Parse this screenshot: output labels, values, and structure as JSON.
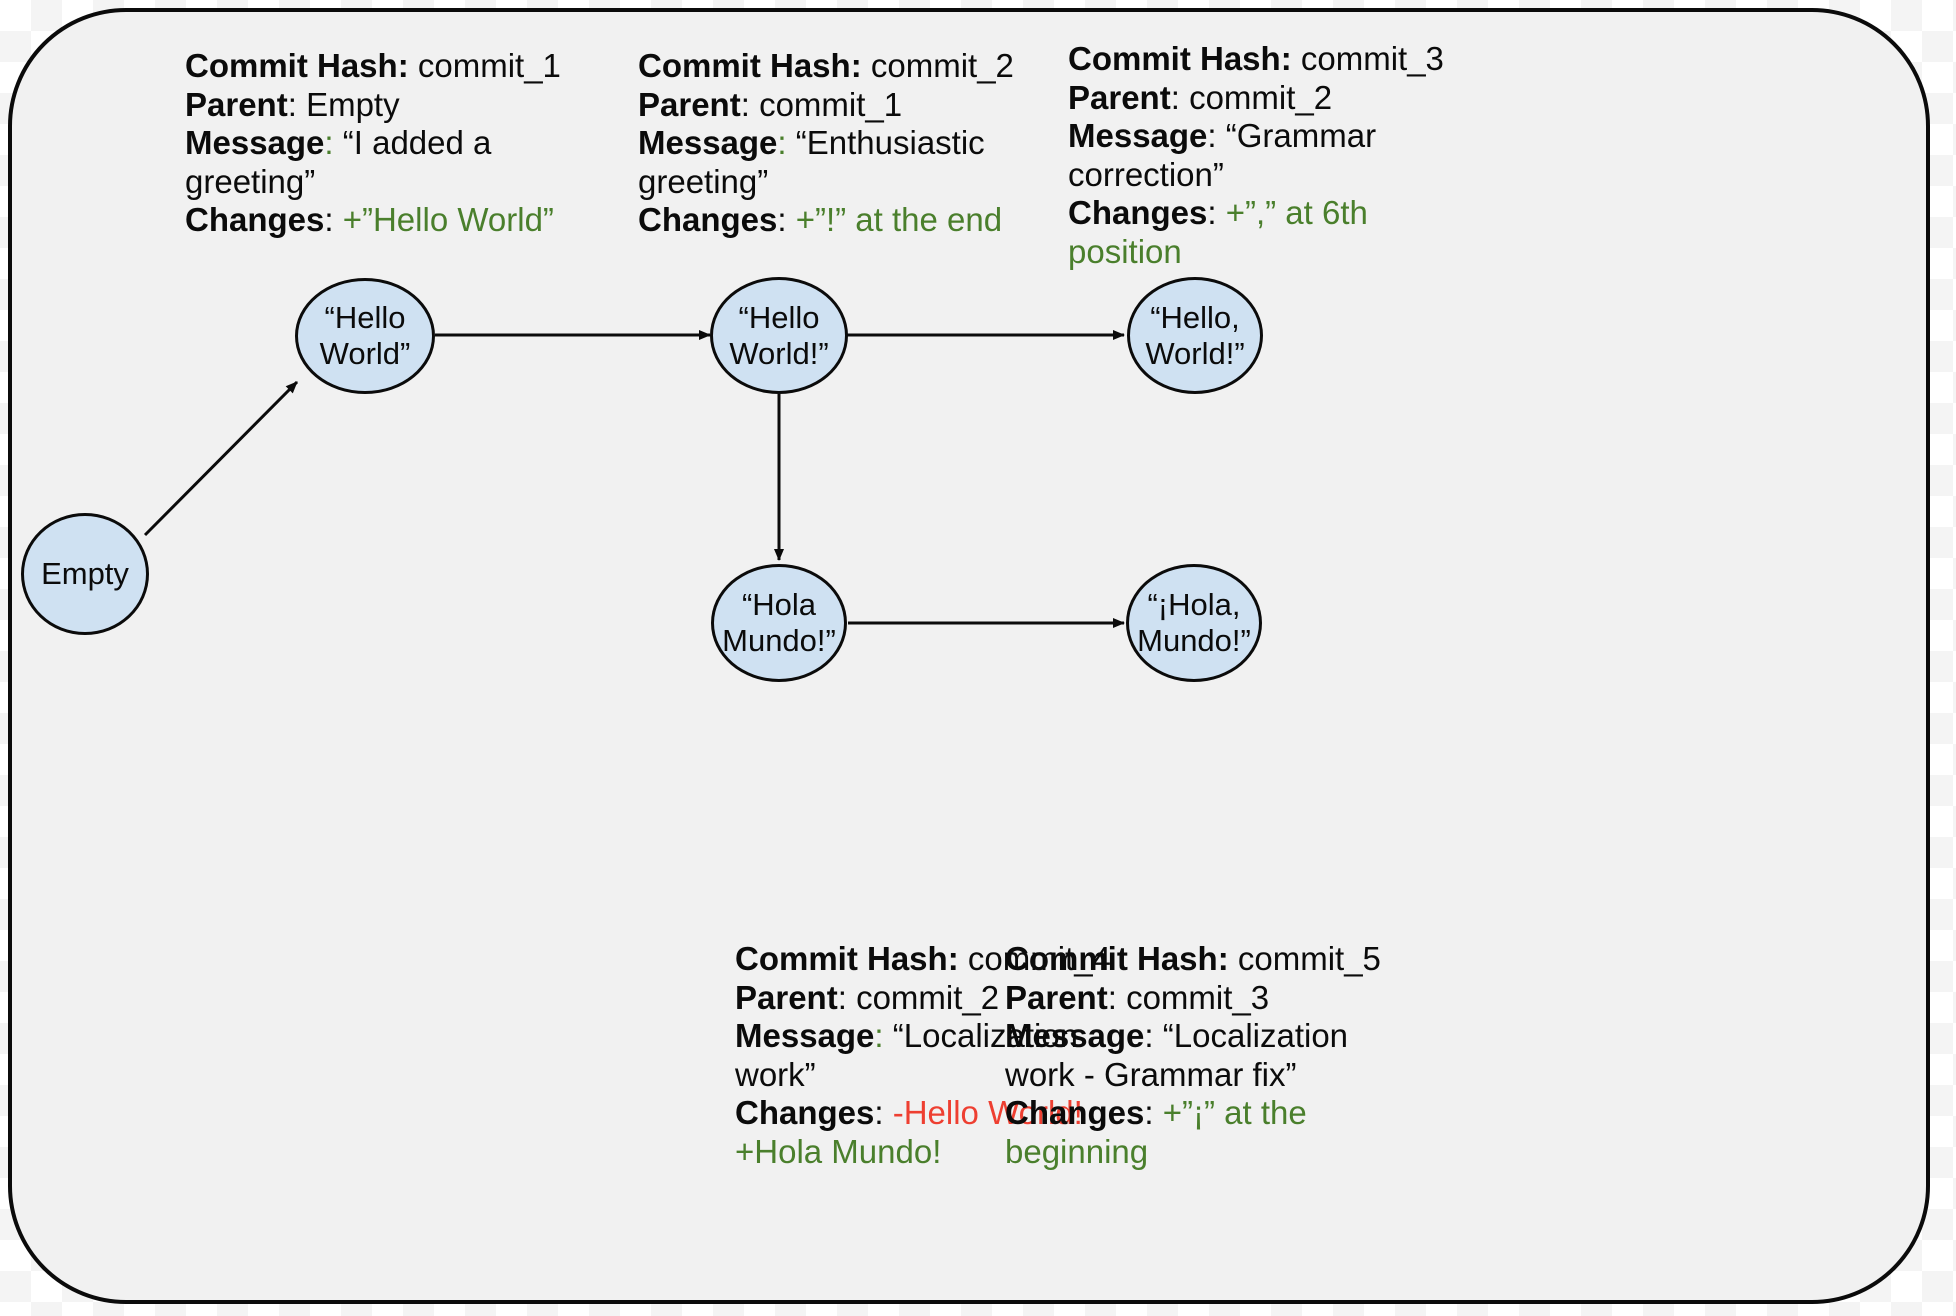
{
  "diagram": {
    "title": "Git commit history DAG",
    "colors": {
      "node_fill": "#cfe1f2",
      "node_stroke": "#0b0b0b",
      "canvas": "#f1f1f1",
      "added": "#4a7f2c",
      "removed": "#ee3f31"
    }
  },
  "nodes": [
    {
      "id": "empty",
      "label": "Empty"
    },
    {
      "id": "c1",
      "label": "“Hello\nWorld”"
    },
    {
      "id": "c2",
      "label": "“Hello\nWorld!”"
    },
    {
      "id": "c3",
      "label": "“Hello,\nWorld!”"
    },
    {
      "id": "c4",
      "label": "“Hola\nMundo!”"
    },
    {
      "id": "c5",
      "label": "“¡Hola,\nMundo!”"
    }
  ],
  "edges": [
    {
      "from": "empty",
      "to": "c1"
    },
    {
      "from": "c1",
      "to": "c2"
    },
    {
      "from": "c2",
      "to": "c3"
    },
    {
      "from": "c2",
      "to": "c4"
    },
    {
      "from": "c4",
      "to": "c5"
    }
  ],
  "labels": {
    "commit_hash": "Commit Hash",
    "parent": "Parent",
    "message": "Message",
    "changes": "Changes",
    "colon": ":"
  },
  "commits": [
    {
      "hash": "commit_1",
      "parent": "Empty",
      "message": "“I added a greeting”",
      "changes_added": "+”Hello World”",
      "changes_removed": ""
    },
    {
      "hash": "commit_2",
      "parent": "commit_1",
      "message": "“Enthusiastic greeting”",
      "changes_added": "+”!” at the end",
      "changes_removed": ""
    },
    {
      "hash": "commit_3",
      "parent": "commit_2",
      "message": "“Grammar correction”",
      "changes_added": "+”,” at 6th position",
      "changes_removed": ""
    },
    {
      "hash": "commit_4",
      "parent": "commit_2",
      "message": "“Localization work”",
      "changes_removed": "-Hello World!",
      "changes_added": "+Hola Mundo!"
    },
    {
      "hash": "commit_5",
      "parent": "commit_3",
      "message": "“Localization work - Grammar fix”",
      "changes_added": "+”¡” at the beginning",
      "changes_removed": ""
    }
  ]
}
